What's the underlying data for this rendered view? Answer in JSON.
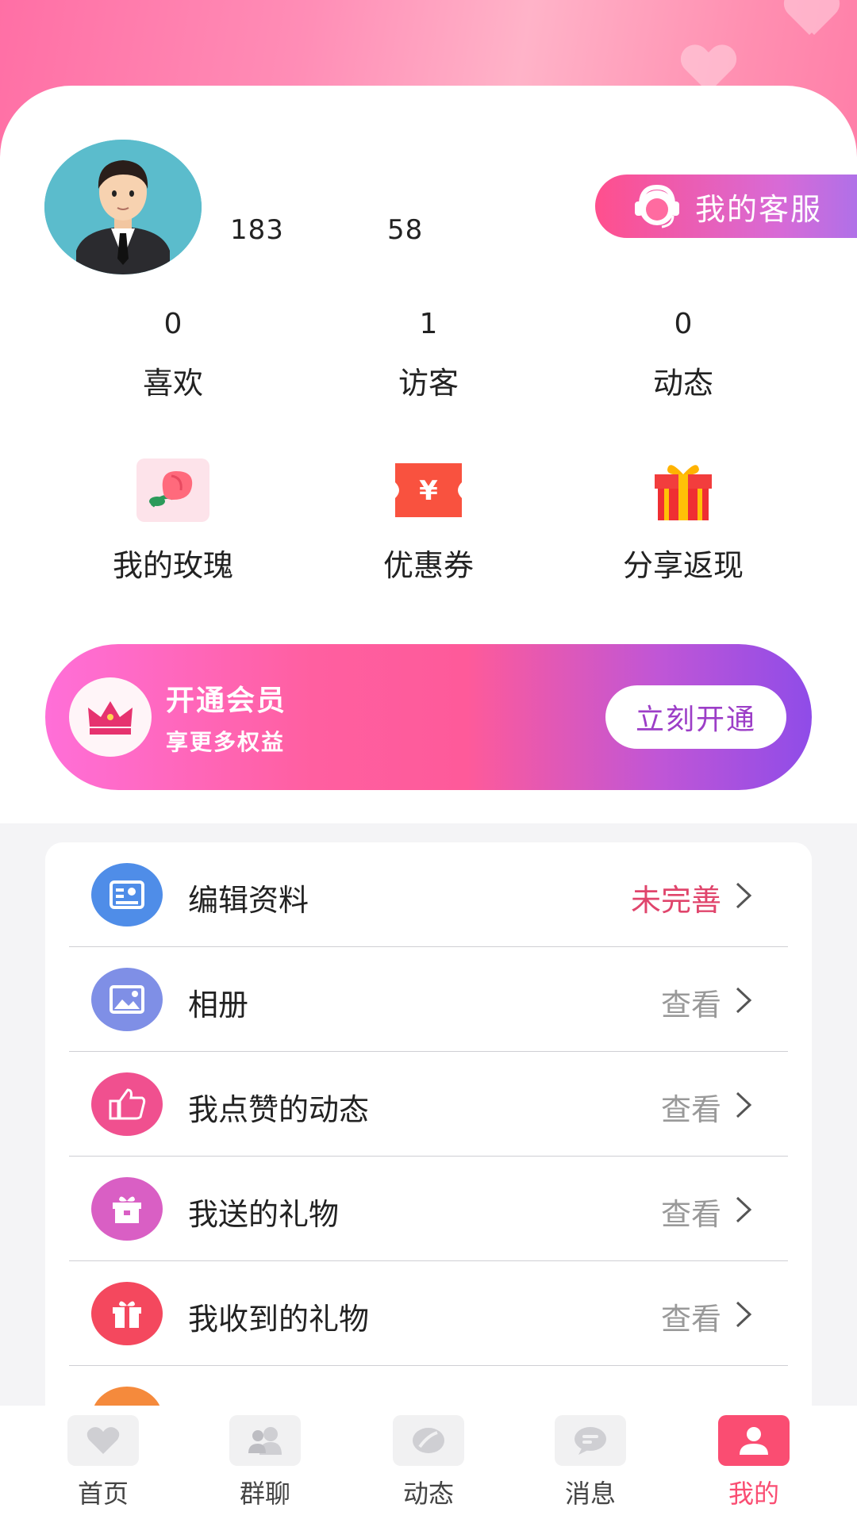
{
  "profile": {
    "stat_a": "183",
    "stat_b": "58",
    "service_label": "我的客服"
  },
  "stats": [
    {
      "value": "0",
      "label": "喜欢"
    },
    {
      "value": "1",
      "label": "访客"
    },
    {
      "value": "0",
      "label": "动态"
    }
  ],
  "features": [
    {
      "label": "我的玫瑰",
      "icon": "rose-icon"
    },
    {
      "label": "优惠券",
      "icon": "coupon-icon"
    },
    {
      "label": "分享返现",
      "icon": "gift-box-icon"
    }
  ],
  "vip": {
    "title": "开通会员",
    "subtitle": "享更多权益",
    "button": "立刻开通",
    "icon": "crown-icon"
  },
  "menu": [
    {
      "label": "编辑资料",
      "value": "未完善",
      "icon": "profile-card-icon",
      "color": "#4f8de8"
    },
    {
      "label": "相册",
      "value": "查看",
      "icon": "image-icon",
      "color": "#7f8fe6"
    },
    {
      "label": "我点赞的动态",
      "value": "查看",
      "icon": "thumbs-up-icon",
      "color": "#f0508f"
    },
    {
      "label": "我送的礼物",
      "value": "查看",
      "icon": "gift-icon",
      "color": "#d95fc4"
    },
    {
      "label": "我收到的礼物",
      "value": "查看",
      "icon": "gift-icon",
      "color": "#f4485e"
    }
  ],
  "tabs": [
    {
      "label": "首页",
      "icon": "heart-icon",
      "active": false
    },
    {
      "label": "群聊",
      "icon": "group-icon",
      "active": false
    },
    {
      "label": "动态",
      "icon": "leaf-icon",
      "active": false
    },
    {
      "label": "消息",
      "icon": "chat-icon",
      "active": false
    },
    {
      "label": "我的",
      "icon": "user-icon",
      "active": true
    }
  ],
  "colors": {
    "accent": "#fa4d72",
    "alert": "#e0456c",
    "header_pink": "#ff7ea8"
  }
}
